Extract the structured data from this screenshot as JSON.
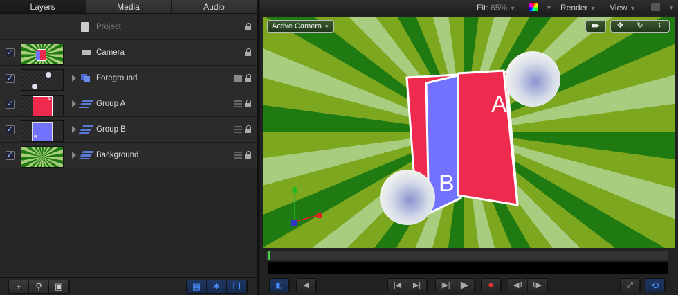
{
  "tabs": [
    {
      "label": "Layers"
    },
    {
      "label": "Media"
    },
    {
      "label": "Audio"
    }
  ],
  "project_label": "Project",
  "layers": [
    {
      "name": "Camera",
      "checked": true
    },
    {
      "name": "Foreground",
      "checked": true
    },
    {
      "name": "Group  A",
      "checked": true
    },
    {
      "name": "Group B",
      "checked": true
    },
    {
      "name": "Background",
      "checked": true
    }
  ],
  "viewer": {
    "fit_label": "Fit:",
    "fit_value": "65%",
    "render": "Render",
    "view": "View",
    "camera_menu": "Active Camera"
  },
  "scene": {
    "card_a": "A",
    "card_b": "B",
    "thumb_a": "A",
    "thumb_b": "B"
  },
  "colors": {
    "accent": "#4a8cff",
    "red_card": "#ee2a4f",
    "blue_card": "#7272ff"
  }
}
